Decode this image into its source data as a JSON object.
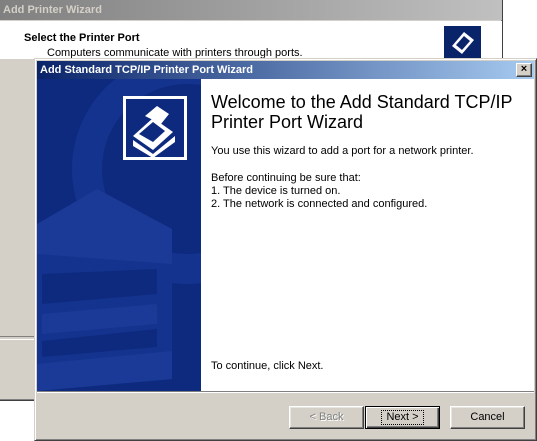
{
  "back_window": {
    "title": "Add Printer Wizard",
    "heading": "Select the Printer Port",
    "subtext": "Computers communicate with printers through ports."
  },
  "window": {
    "title": "Add Standard TCP/IP Printer Port Wizard",
    "close_label": "×"
  },
  "main": {
    "heading": "Welcome to the Add Standard TCP/IP Printer Port Wizard",
    "intro": "You use this wizard to add a port for a network printer.",
    "before_label": "Before continuing be sure that:",
    "items": [
      "1.  The device is turned on.",
      "2.  The network is connected and configured."
    ],
    "continue_text": "To continue, click Next."
  },
  "buttons": {
    "back_label": "< Back",
    "next_label": "Next >",
    "cancel_label": "Cancel"
  },
  "colors": {
    "active_title": "#0a246a",
    "inactive_title": "#808080",
    "sidebar": "#0d2a7e",
    "face": "#d4d0c8"
  }
}
